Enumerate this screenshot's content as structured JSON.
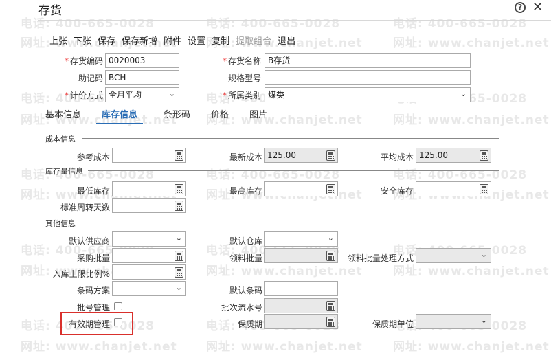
{
  "window": {
    "title": "存货"
  },
  "toolbar": {
    "items": [
      "上张",
      "下张",
      "保存",
      "保存新增",
      "附件",
      "设置",
      "复制",
      "提取组合",
      "退出"
    ]
  },
  "header_fields": {
    "code_label": "存货编码",
    "code_value": "0020003",
    "name_label": "存货名称",
    "name_value": "B存货",
    "mnemonic_label": "助记码",
    "mnemonic_value": "BCH",
    "spec_label": "规格型号",
    "spec_value": "",
    "pricing_label": "计价方式",
    "pricing_value": "全月平均",
    "category_label": "所属类别",
    "category_value": "煤类"
  },
  "tabs": [
    "基本信息",
    "库存信息",
    "条形码",
    "价格",
    "图片"
  ],
  "sections": {
    "cost": "成本信息",
    "stock": "库存量信息",
    "other": "其他信息"
  },
  "cost": {
    "ref_label": "参考成本",
    "ref_value": "",
    "latest_label": "最新成本",
    "latest_value": "125.00",
    "avg_label": "平均成本",
    "avg_value": "125.00"
  },
  "stock": {
    "min_label": "最低库存",
    "max_label": "最高库存",
    "safe_label": "安全库存",
    "turnover_label": "标准周转天数"
  },
  "other": {
    "supplier_label": "默认供应商",
    "warehouse_label": "默认仓库",
    "purchase_batch_label": "采购批量",
    "pick_batch_label": "领料批量",
    "pick_method_label": "领料批量处理方式",
    "inbound_ratio_label": "入库上限比例%",
    "barcode_scheme_label": "条码方案",
    "default_barcode_label": "默认条码",
    "batch_mgmt_label": "批号管理",
    "batch_serial_label": "批次流水号",
    "expiry_mgmt_label": "有效期管理",
    "shelf_life_label": "保质期",
    "shelf_unit_label": "保质期单位"
  },
  "watermarks": {
    "phone": "电话: 400-665-0028",
    "site": "网址: www.chanjet.net"
  }
}
